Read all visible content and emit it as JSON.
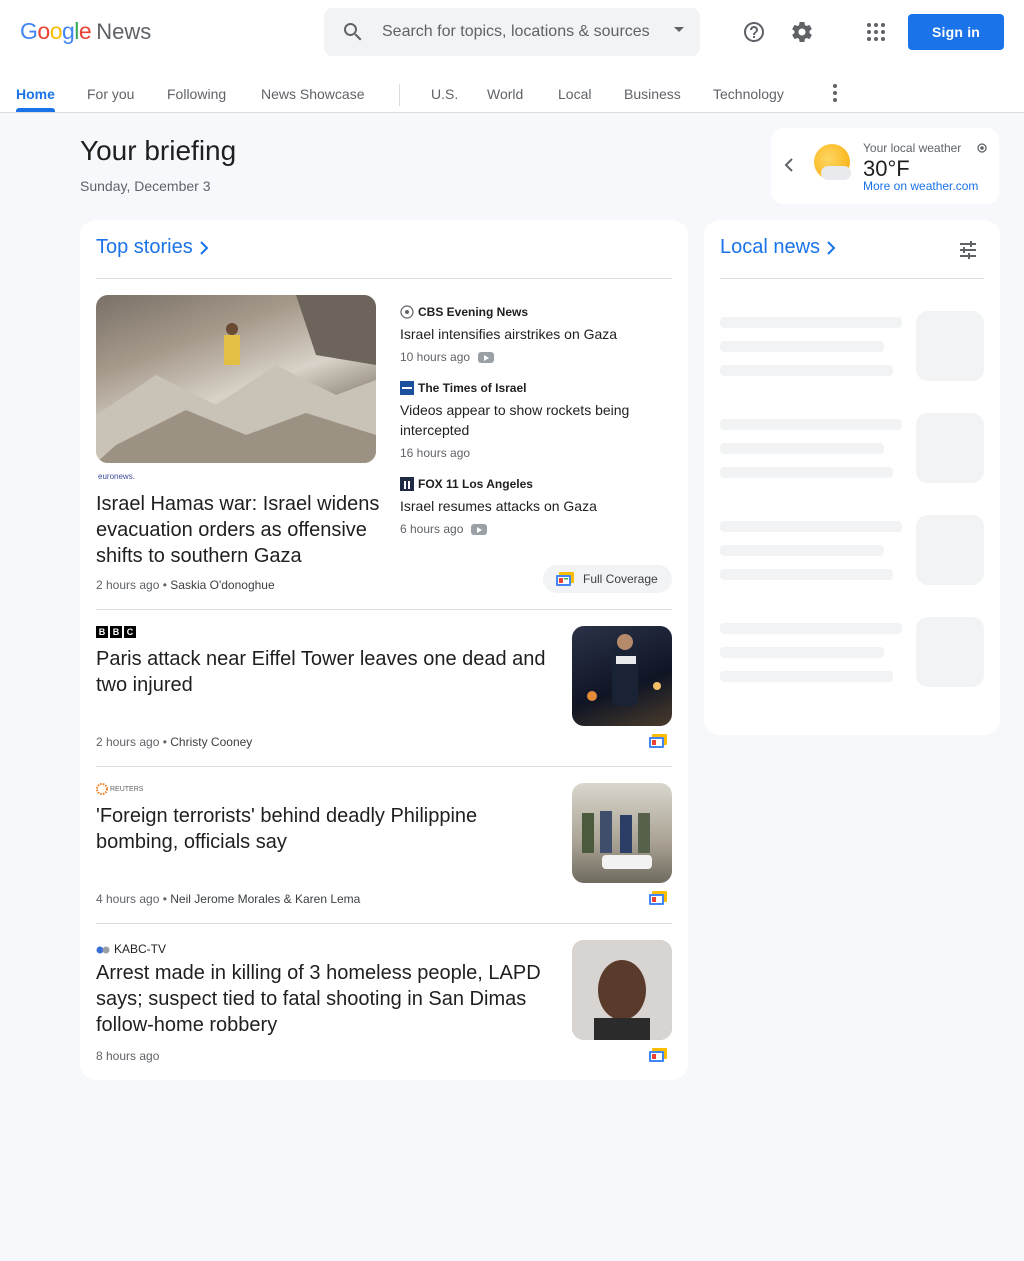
{
  "header": {
    "logo_word": "Google",
    "logo_news": "News",
    "search_placeholder": "Search for topics, locations & sources",
    "sign_in": "Sign in",
    "brand_blue": "#1a73e8"
  },
  "nav": {
    "items": [
      {
        "label": "Home",
        "active": true
      },
      {
        "label": "For you"
      },
      {
        "label": "Following"
      },
      {
        "label": "News Showcase"
      },
      {
        "label": "U.S."
      },
      {
        "label": "World"
      },
      {
        "label": "Local"
      },
      {
        "label": "Business"
      },
      {
        "label": "Technology"
      }
    ]
  },
  "briefing": {
    "title": "Your briefing",
    "date": "Sunday, December 3"
  },
  "weather": {
    "label": "Your local weather",
    "temp": "30°F",
    "link": "More on weather.com"
  },
  "top_stories": {
    "title": "Top stories",
    "hero": {
      "publisher": "euronews.",
      "title": "Israel Hamas war: Israel widens evacuation orders as offensive shifts to southern Gaza",
      "time": "2 hours ago",
      "author": "Saskia O'donoghue"
    },
    "related": [
      {
        "source": "CBS Evening News",
        "title": "Israel intensifies airstrikes on Gaza",
        "time": "10 hours ago",
        "video": true
      },
      {
        "source": "The Times of Israel",
        "title": "Videos appear to show rockets being intercepted",
        "time": "16 hours ago",
        "video": false
      },
      {
        "source": "FOX 11 Los Angeles",
        "title": "Israel resumes attacks on Gaza",
        "time": "6 hours ago",
        "video": true
      }
    ],
    "full_coverage": "Full Coverage",
    "stories": [
      {
        "publisher": "BBC",
        "title": "Paris attack near Eiffel Tower leaves one dead and two injured",
        "time": "2 hours ago",
        "author": "Christy Cooney"
      },
      {
        "publisher": "REUTERS",
        "title": "'Foreign terrorists' behind deadly Philippine bombing, officials say",
        "time": "4 hours ago",
        "author": "Neil Jerome Morales & Karen Lema"
      },
      {
        "publisher": "KABC-TV",
        "title": "Arrest made in killing of 3 homeless people, LAPD says; suspect tied to fatal shooting in San Dimas follow-home robbery",
        "time": "8 hours ago",
        "author": ""
      }
    ]
  },
  "local_news": {
    "title": "Local news"
  }
}
